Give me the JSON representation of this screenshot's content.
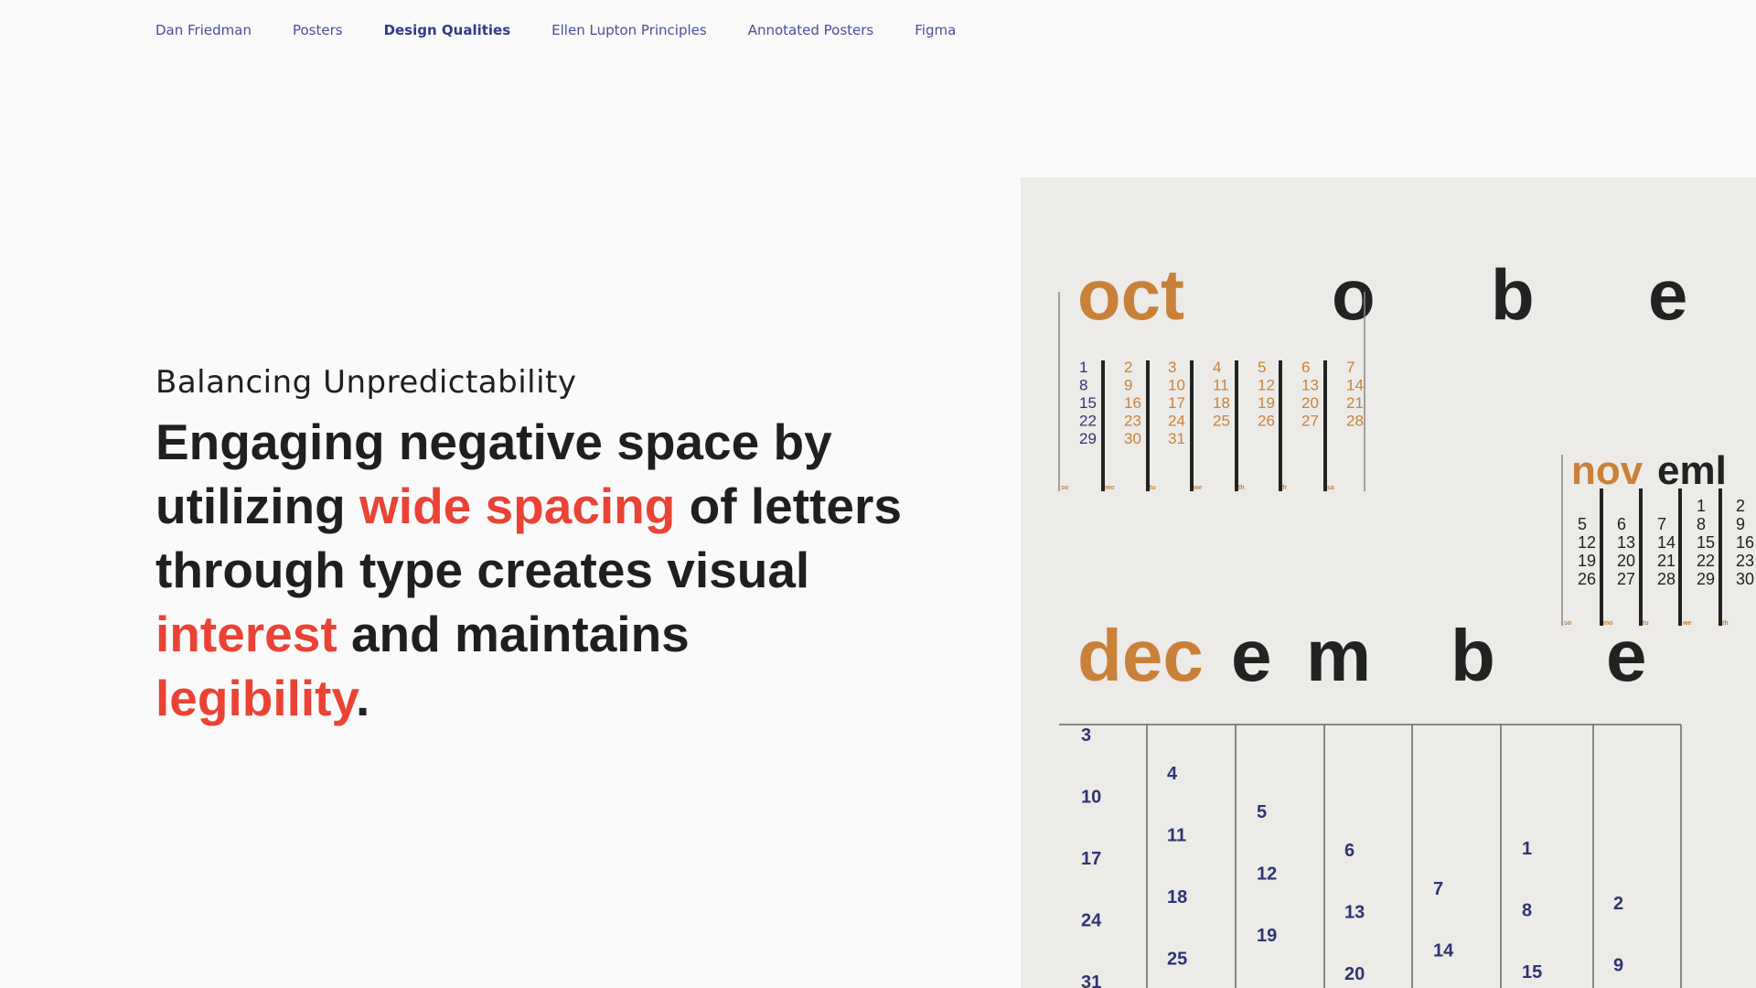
{
  "nav": {
    "items": [
      {
        "label": "Dan Friedman",
        "active": false
      },
      {
        "label": "Posters",
        "active": false
      },
      {
        "label": "Design Qualities",
        "active": true
      },
      {
        "label": "Ellen Lupton Principles",
        "active": false
      },
      {
        "label": "Annotated Posters",
        "active": false
      },
      {
        "label": "Figma",
        "active": false
      }
    ]
  },
  "section": {
    "eyebrow": "Balancing Unpredictability",
    "headline": {
      "part1": "Engaging negative space by utilizing ",
      "highlight1": "wide spacing",
      "part2": " of letters through type creates visual ",
      "highlight2": "interest",
      "part3": " and maintains ",
      "highlight3": "legibility",
      "part4": "."
    }
  },
  "colors": {
    "background": "#fafafa",
    "nav_text": "#4a4e9c",
    "heading_text": "#1f1f1f",
    "highlight": "#ea4335",
    "poster_orange": "#c9813a",
    "poster_navy": "#2e3472",
    "poster_black": "#222222"
  },
  "poster": {
    "october": {
      "prefix": "oct",
      "letters": [
        "o",
        "b",
        "e"
      ],
      "columns": [
        [
          "1",
          "8",
          "15",
          "22",
          "29"
        ],
        [
          "2",
          "9",
          "16",
          "23",
          "30"
        ],
        [
          "3",
          "10",
          "17",
          "24",
          "31"
        ],
        [
          "4",
          "11",
          "18",
          "25"
        ],
        [
          "5",
          "12",
          "19",
          "26"
        ],
        [
          "6",
          "13",
          "20",
          "27"
        ],
        [
          "7",
          "14",
          "21",
          "28"
        ]
      ],
      "days": [
        "so",
        "mo",
        "tu",
        "we",
        "th",
        "fr",
        "sa"
      ]
    },
    "november": {
      "prefix": "nov",
      "rest": "eml",
      "columns": [
        [
          "5",
          "12",
          "19",
          "26"
        ],
        [
          "6",
          "13",
          "20",
          "27"
        ],
        [
          "7",
          "14",
          "21",
          "28"
        ],
        [
          "1",
          "8",
          "15",
          "22",
          "29"
        ],
        [
          "2",
          "9",
          "16",
          "23",
          "30"
        ]
      ],
      "days": [
        "so",
        "mo",
        "tu",
        "we",
        "th"
      ]
    },
    "december": {
      "prefix": "dec",
      "letters": [
        "e",
        "m",
        "b",
        "e"
      ],
      "columns": [
        [
          "3",
          "10",
          "17",
          "24",
          "31"
        ],
        [
          "4",
          "11",
          "18",
          "25"
        ],
        [
          "5",
          "12",
          "19"
        ],
        [
          "6",
          "13",
          "20"
        ],
        [
          "7",
          "14"
        ],
        [
          "1",
          "8",
          "15"
        ],
        [
          "2",
          "9"
        ]
      ]
    }
  }
}
